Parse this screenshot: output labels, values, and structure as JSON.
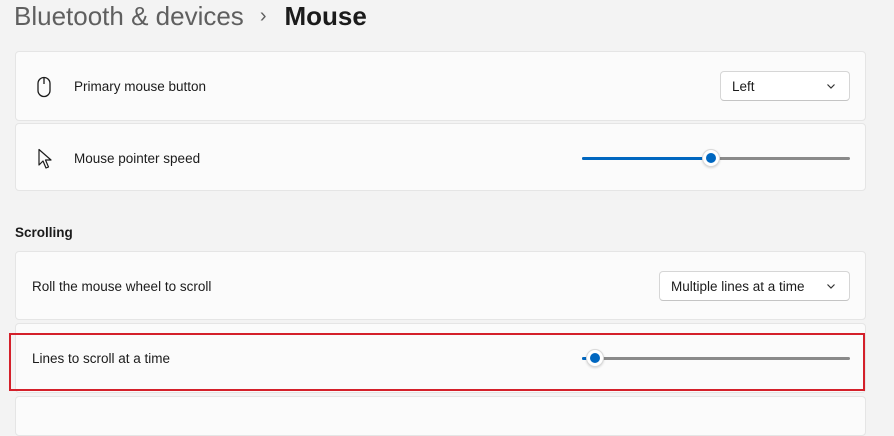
{
  "breadcrumb": {
    "parent": "Bluetooth & devices",
    "separator": "›",
    "current": "Mouse"
  },
  "settings": {
    "primary_button": {
      "label": "Primary mouse button",
      "icon": "mouse-icon",
      "value": "Left"
    },
    "pointer_speed": {
      "label": "Mouse pointer speed",
      "icon": "pointer-arrow-icon",
      "level_fraction": 0.48
    }
  },
  "scrolling": {
    "title": "Scrolling",
    "roll_wheel": {
      "label": "Roll the mouse wheel to scroll",
      "value": "Multiple lines at a time"
    },
    "lines_to_scroll": {
      "label": "Lines to scroll at a time",
      "level_fraction": 0.05
    }
  },
  "colors": {
    "accent": "#0067c0",
    "highlight_border": "#d4202a",
    "background": "#f3f3f3",
    "card": "#fbfbfb"
  }
}
